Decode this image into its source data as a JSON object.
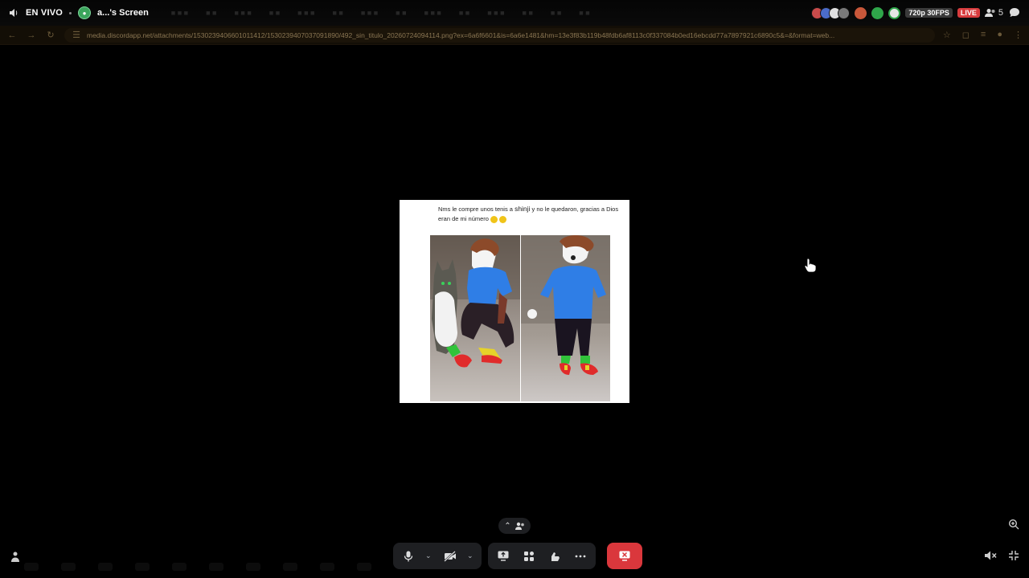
{
  "stream": {
    "live_label": "EN VIVO",
    "screen_name": "a...'s Screen",
    "quality": "720p 30FPS",
    "live_badge": "LIVE",
    "viewer_count": "5"
  },
  "browser": {
    "url": "media.discordapp.net/attachments/1530239406601011412/1530239407037091890/492_sin_titulo_20260724094114.png?ex=6a6f6601&is=6a6e1481&hm=13e3f83b119b48fdb6af8113c0f337084b0ed16ebcdd77a7897921c6890c5&=&format=web..."
  },
  "meme": {
    "caption_part1": "Nms le compre unos tenis a",
    "caption_name": "shinji",
    "caption_part2": "y no le quedaron, gracias a Dios eran de mi número"
  },
  "controls": {
    "accent_end_call": "#da373c"
  }
}
